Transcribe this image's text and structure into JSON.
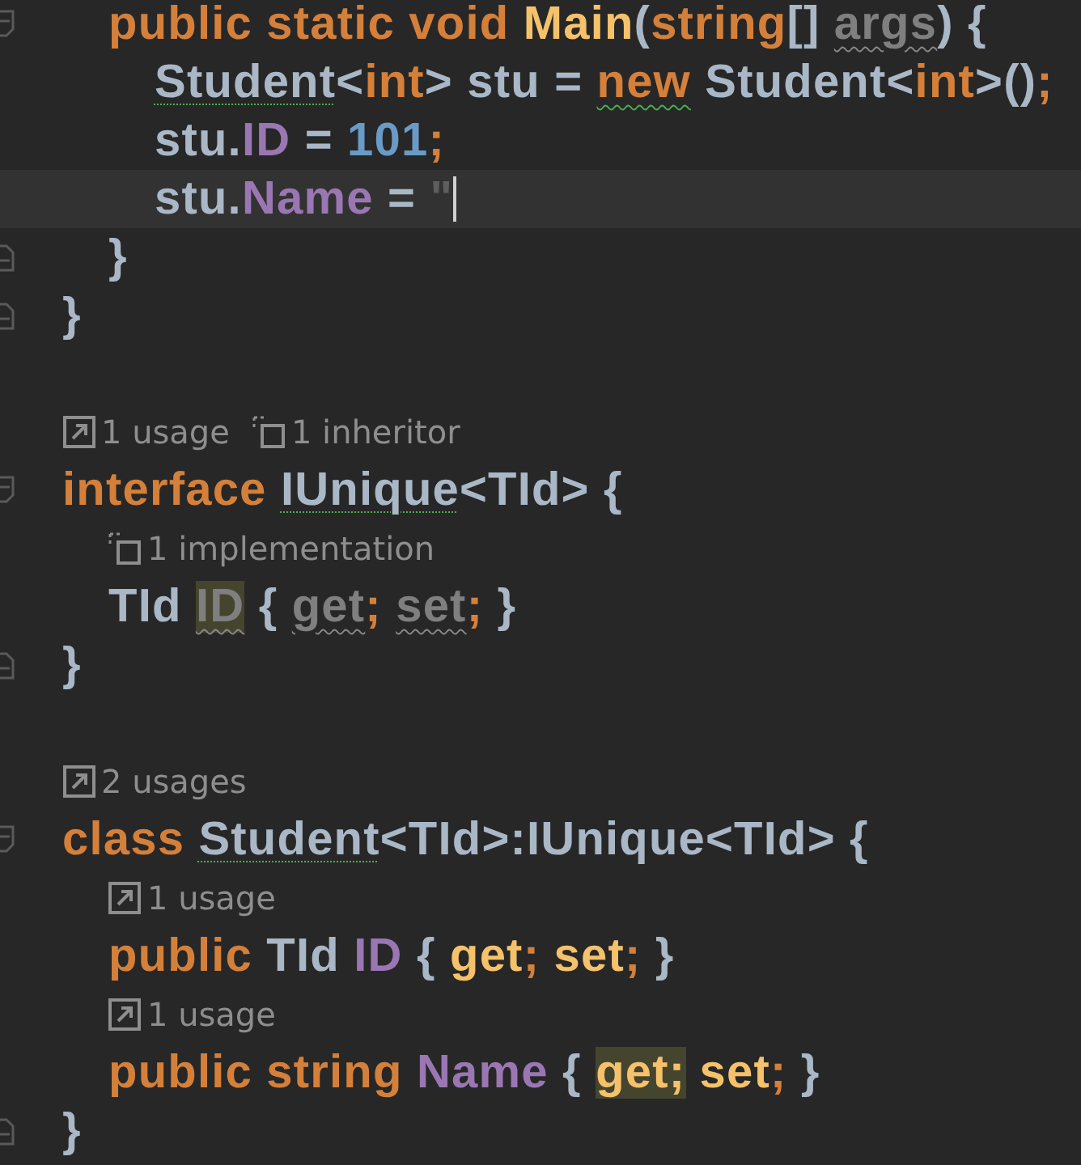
{
  "lines": [
    {
      "kind": "group",
      "children": [
        {
          "kind": "code",
          "fold_marker": true,
          "tokens": [
            {
              "text": "public static void ",
              "kind": "keyword"
            },
            {
              "text": "Main",
              "kind": "method"
            },
            {
              "text": "(",
              "kind": "punct"
            },
            {
              "text": "string",
              "kind": "keyword"
            },
            {
              "text": "[] ",
              "kind": "punct"
            },
            {
              "text": "args",
              "kind": "unused",
              "underlined": true
            },
            {
              "text": ") {",
              "kind": "punct"
            }
          ],
          "children": [
            {
              "kind": "code",
              "fold_marker": false,
              "tokens": [
                {
                  "text": "Student",
                  "kind": "type",
                  "underlined": true
                },
                {
                  "text": "<",
                  "kind": "punct"
                },
                {
                  "text": "int",
                  "kind": "keyword"
                },
                {
                  "text": "> stu = ",
                  "kind": "punct"
                },
                {
                  "text": "new",
                  "kind": "keyword",
                  "underlined": true
                },
                {
                  "text": " Student<",
                  "kind": "type"
                },
                {
                  "text": "int",
                  "kind": "keyword"
                },
                {
                  "text": ">()",
                  "kind": "punct"
                },
                {
                  "text": ";",
                  "kind": "keyword"
                }
              ]
            },
            {
              "kind": "code",
              "fold_marker": false,
              "tokens": [
                {
                  "text": "stu.",
                  "kind": "punct"
                },
                {
                  "text": "ID",
                  "kind": "member"
                },
                {
                  "text": " = ",
                  "kind": "punct"
                },
                {
                  "text": "101",
                  "kind": "number"
                },
                {
                  "text": ";",
                  "kind": "keyword"
                }
              ]
            },
            {
              "kind": "code",
              "fold_marker": false,
              "current": true,
              "caret": true,
              "tokens": [
                {
                  "text": "stu.",
                  "kind": "punct"
                },
                {
                  "text": "Name",
                  "kind": "member"
                },
                {
                  "text": " = ",
                  "kind": "punct"
                },
                {
                  "text": "\"",
                  "kind": "ghost"
                }
              ]
            }
          ]
        },
        {
          "kind": "code",
          "fold_marker": true,
          "tokens": [
            {
              "text": "}",
              "kind": "punct"
            }
          ]
        }
      ]
    },
    {
      "kind": "code",
      "fold_marker": true,
      "tokens": [
        {
          "text": "}",
          "kind": "punct"
        }
      ]
    },
    {
      "kind": "blank"
    },
    {
      "kind": "hint",
      "items": [
        {
          "kind": "usages",
          "text": "1 usage"
        },
        {
          "kind": "inheritors",
          "text": "1 inheritor"
        }
      ]
    },
    {
      "kind": "code",
      "fold_marker": true,
      "tokens": [
        {
          "text": "interface ",
          "kind": "keyword"
        },
        {
          "text": "IUnique",
          "kind": "type",
          "underlined": true
        },
        {
          "text": "<TId> {",
          "kind": "punct"
        }
      ],
      "children": [
        {
          "kind": "hint",
          "items": [
            {
              "kind": "inheritors",
              "text": "1 implementation"
            }
          ]
        },
        {
          "kind": "code",
          "fold_marker": false,
          "tokens": [
            {
              "text": "TId ",
              "kind": "punct"
            },
            {
              "text": "ID",
              "kind": "unused",
              "highlight": true,
              "underlined": true
            },
            {
              "text": " { ",
              "kind": "punct"
            },
            {
              "text": "get",
              "kind": "unused",
              "underlined": true
            },
            {
              "text": "; ",
              "kind": "keyword"
            },
            {
              "text": "set",
              "kind": "unused",
              "underlined": true
            },
            {
              "text": ";",
              "kind": "keyword"
            },
            {
              "text": " }",
              "kind": "punct"
            }
          ]
        }
      ]
    },
    {
      "kind": "code",
      "fold_marker": true,
      "tokens": [
        {
          "text": "}",
          "kind": "punct"
        }
      ]
    },
    {
      "kind": "blank"
    },
    {
      "kind": "hint",
      "items": [
        {
          "kind": "usages",
          "text": "2 usages"
        }
      ]
    },
    {
      "kind": "code",
      "fold_marker": true,
      "tokens": [
        {
          "text": "class ",
          "kind": "keyword"
        },
        {
          "text": "Student",
          "kind": "type",
          "underlined": true
        },
        {
          "text": "<TId>:IUnique<TId> {",
          "kind": "punct"
        }
      ],
      "children": [
        {
          "kind": "hint",
          "items": [
            {
              "kind": "usages",
              "text": "1 usage"
            }
          ]
        },
        {
          "kind": "code",
          "fold_marker": false,
          "tokens": [
            {
              "text": "public ",
              "kind": "keyword"
            },
            {
              "text": "TId ",
              "kind": "punct"
            },
            {
              "text": "ID",
              "kind": "member"
            },
            {
              "text": " { ",
              "kind": "punct"
            },
            {
              "text": "get",
              "kind": "method"
            },
            {
              "text": "; ",
              "kind": "keyword"
            },
            {
              "text": "set",
              "kind": "method"
            },
            {
              "text": ";",
              "kind": "keyword"
            },
            {
              "text": " }",
              "kind": "punct"
            }
          ]
        },
        {
          "kind": "hint",
          "items": [
            {
              "kind": "usages",
              "text": "1 usage"
            }
          ]
        },
        {
          "kind": "code",
          "fold_marker": false,
          "tokens": [
            {
              "text": "public string ",
              "kind": "keyword"
            },
            {
              "text": "Name",
              "kind": "member"
            },
            {
              "text": " { ",
              "kind": "punct"
            },
            {
              "text": "get;",
              "kind": "method",
              "highlight": true
            },
            {
              "text": " set",
              "kind": "method"
            },
            {
              "text": ";",
              "kind": "keyword"
            },
            {
              "text": " }",
              "kind": "punct"
            }
          ]
        }
      ]
    },
    {
      "kind": "code",
      "fold_marker": true,
      "tokens": [
        {
          "text": "}",
          "kind": "punct"
        }
      ]
    }
  ]
}
